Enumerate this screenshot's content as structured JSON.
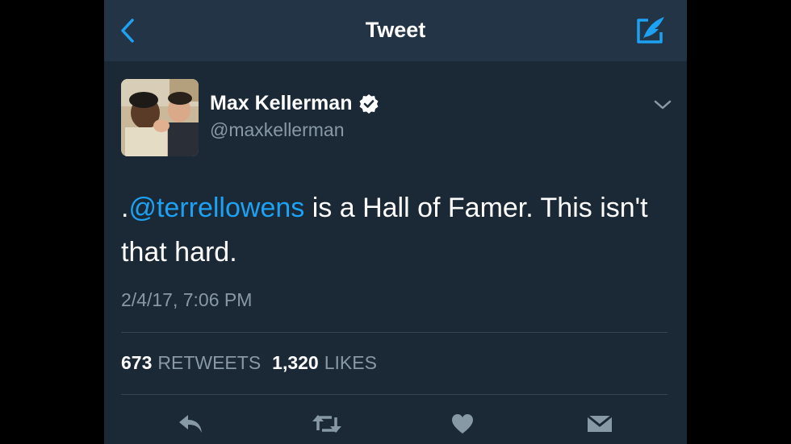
{
  "navbar": {
    "title": "Tweet",
    "accent_color": "#1da1f2"
  },
  "tweet": {
    "author": {
      "display_name": "Max Kellerman",
      "handle": "@maxkellerman",
      "verified": true
    },
    "text_prefix": ".",
    "mention": "@terrellowens",
    "text_body": " is a Hall of Famer. This isn't that hard.",
    "timestamp": "2/4/17, 7:06 PM",
    "retweets_count": "673",
    "retweets_label": "RETWEETS",
    "likes_count": "1,320",
    "likes_label": "LIKES"
  },
  "icons": {
    "back": "chevron-left-icon",
    "compose": "compose-tweet-icon",
    "verified": "verified-badge-icon",
    "menu": "chevron-down-icon",
    "reply": "reply-icon",
    "retweet": "retweet-icon",
    "like": "heart-icon",
    "dm": "direct-message-icon"
  },
  "colors": {
    "background": "#1b2836",
    "navbar": "#243447",
    "secondary_text": "#8899a6",
    "icon": "#8899a6"
  }
}
